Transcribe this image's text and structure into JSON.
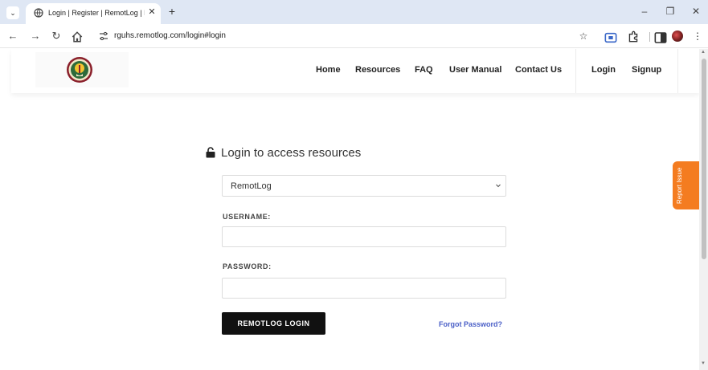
{
  "browser": {
    "tab_title": "Login | Register | RemotLog | R",
    "url": "rguhs.remotlog.com/login#login",
    "icons": [
      "tab-list-icon",
      "globe-icon",
      "close-icon",
      "new-tab-icon",
      "minimize-icon",
      "restore-icon",
      "window-close-icon",
      "back-icon",
      "forward-icon",
      "reload-icon",
      "home-icon",
      "site-info-icon",
      "bookmark-star-icon",
      "extension-icon",
      "puzzle-icon",
      "sidepanel-icon",
      "profile-avatar"
    ],
    "glyphs": {
      "tab_list": "⌄",
      "tab_close": "✕",
      "new_tab": "+",
      "minimize": "–",
      "restore": "❐",
      "window_close": "✕",
      "back": "←",
      "forward": "→",
      "reload": "↻",
      "bookmark": "☆",
      "menu": "⋮"
    }
  },
  "header": {
    "nav": [
      {
        "label": "Home"
      },
      {
        "label": "Resources"
      },
      {
        "label": "FAQ"
      },
      {
        "label": "User Manual"
      },
      {
        "label": "Contact Us"
      },
      {
        "label": "Login"
      },
      {
        "label": "Signup"
      }
    ]
  },
  "login": {
    "heading": "Login to access resources",
    "select_value": "RemotLog",
    "username_label": "USERNAME:",
    "username_value": "",
    "password_label": "PASSWORD:",
    "password_value": "",
    "button_label": "REMOTLOG LOGIN",
    "forgot_label": "Forgot Password?"
  },
  "report_issue": {
    "label": "Report Issue"
  },
  "colors": {
    "tabbar": "#dfe7f4",
    "button": "#111111",
    "link": "#4a5fc7",
    "report_tab": "#f47c20"
  }
}
